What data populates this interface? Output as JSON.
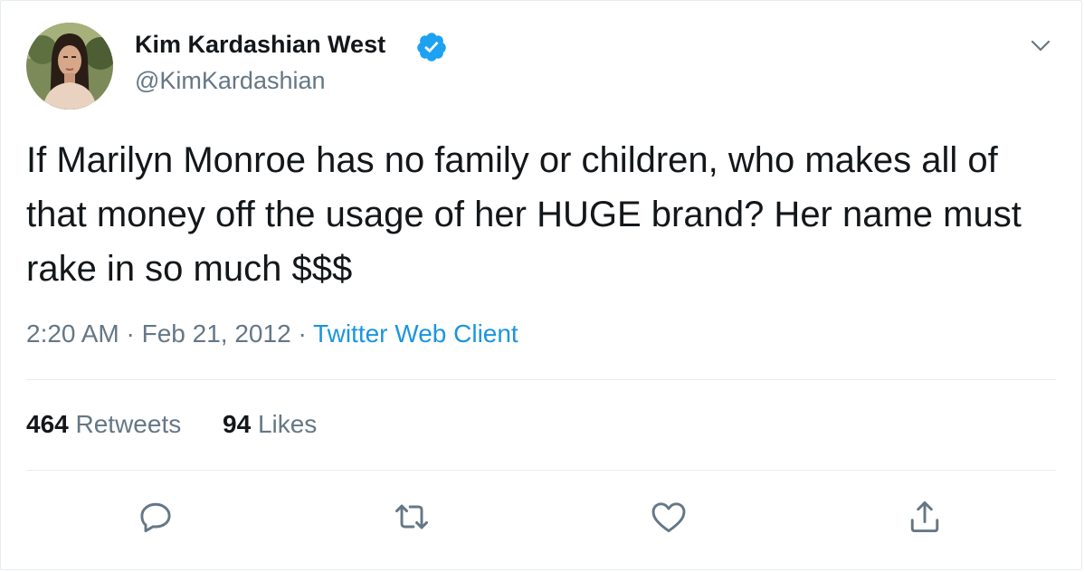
{
  "user": {
    "name": "Kim Kardashian West",
    "handle": "@KimKardashian",
    "verified": true
  },
  "tweet": {
    "text": "If Marilyn Monroe has no family or children, who makes all of that money off the usage of her HUGE brand? Her name must rake in so much $$$",
    "time": "2:20 AM",
    "date": "Feb 21, 2012",
    "separator": "·",
    "source": "Twitter Web Client"
  },
  "stats": {
    "retweets": {
      "count": "464",
      "label": "Retweets"
    },
    "likes": {
      "count": "94",
      "label": "Likes"
    }
  },
  "icons": {
    "verified": "verified-badge-icon",
    "caret": "chevron-down-icon",
    "reply": "reply-icon",
    "retweet": "retweet-icon",
    "like": "heart-icon",
    "share": "share-icon"
  },
  "colors": {
    "text": "#14171a",
    "secondary": "#657786",
    "link": "#1b95e0",
    "verified": "#1da1f2",
    "divider": "#e6ecf0"
  }
}
